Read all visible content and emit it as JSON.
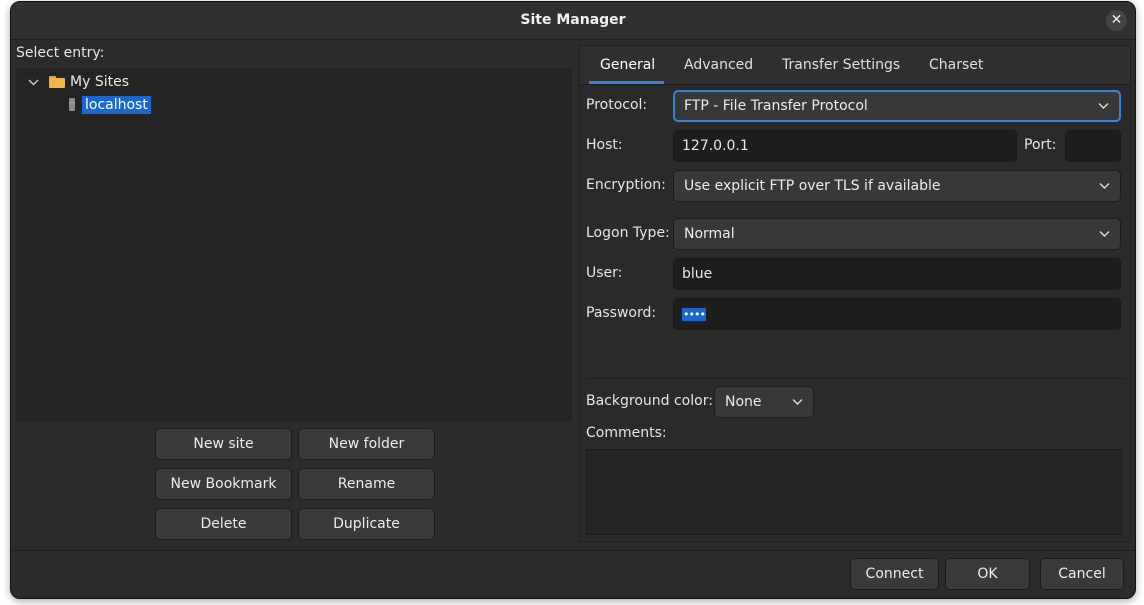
{
  "window": {
    "title": "Site Manager",
    "close_glyph": "✕"
  },
  "tree": {
    "heading": "Select entry:",
    "folder": {
      "label": "My Sites",
      "expanded": true
    },
    "site": {
      "label": "localhost",
      "selected": true
    }
  },
  "left_buttons": {
    "new_site": "New site",
    "new_folder": "New folder",
    "new_bookmark": "New Bookmark",
    "rename": "Rename",
    "delete": "Delete",
    "duplicate": "Duplicate"
  },
  "tabs": [
    {
      "label": "General",
      "active": true
    },
    {
      "label": "Advanced",
      "active": false
    },
    {
      "label": "Transfer Settings",
      "active": false
    },
    {
      "label": "Charset",
      "active": false
    }
  ],
  "general": {
    "protocol_label": "Protocol:",
    "protocol_value": "FTP - File Transfer Protocol",
    "host_label": "Host:",
    "host_value": "127.0.0.1",
    "port_label": "Port:",
    "port_value": "",
    "encryption_label": "Encryption:",
    "encryption_value": "Use explicit FTP over TLS if available",
    "logon_label": "Logon Type:",
    "logon_value": "Normal",
    "user_label": "User:",
    "user_value": "blue",
    "password_label": "Password:",
    "password_value": "••••",
    "bg_color_label": "Background color:",
    "bg_color_value": "None",
    "comments_label": "Comments:",
    "comments_value": ""
  },
  "bottom_buttons": {
    "connect": "Connect",
    "ok": "OK",
    "cancel": "Cancel"
  },
  "colors": {
    "accent": "#3584e4",
    "selection": "#1868d0",
    "folder": "#f0b546"
  }
}
